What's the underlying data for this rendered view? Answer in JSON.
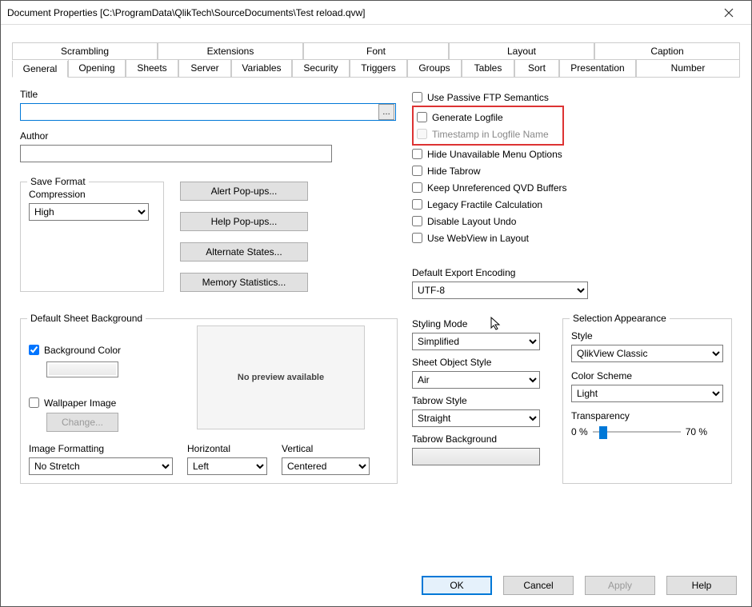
{
  "window": {
    "title": "Document Properties [C:\\ProgramData\\QlikTech\\SourceDocuments\\Test reload.qvw]"
  },
  "tabs_row1": [
    "Scrambling",
    "Extensions",
    "Font",
    "Layout",
    "Caption"
  ],
  "tabs_row2": [
    "General",
    "Opening",
    "Sheets",
    "Server",
    "Variables",
    "Security",
    "Triggers",
    "Groups",
    "Tables",
    "Sort",
    "Presentation",
    "Number"
  ],
  "active_tab": "General",
  "fields": {
    "title_label": "Title",
    "title_value": "",
    "author_label": "Author",
    "author_value": ""
  },
  "save_format": {
    "group_label": "Save Format",
    "compression_label": "Compression",
    "compression_value": "High"
  },
  "buttons_col": {
    "alert": "Alert Pop-ups...",
    "help": "Help Pop-ups...",
    "alt": "Alternate States...",
    "mem": "Memory Statistics..."
  },
  "checkboxes": {
    "passive_ftp": "Use Passive FTP Semantics",
    "gen_log": "Generate Logfile",
    "ts_log": "Timestamp in Logfile Name",
    "hide_menu": "Hide Unavailable Menu Options",
    "hide_tabrow": "Hide Tabrow",
    "keep_qvd": "Keep Unreferenced QVD Buffers",
    "legacy_frac": "Legacy Fractile Calculation",
    "disable_undo": "Disable Layout Undo",
    "webview": "Use WebView in Layout"
  },
  "export": {
    "label": "Default Export Encoding",
    "value": "UTF-8"
  },
  "sheet_bg": {
    "group_label": "Default Sheet Background",
    "bg_color": "Background Color",
    "wallpaper": "Wallpaper Image",
    "change": "Change...",
    "preview": "No preview available",
    "img_fmt_label": "Image Formatting",
    "img_fmt_value": "No Stretch",
    "horiz_label": "Horizontal",
    "horiz_value": "Left",
    "vert_label": "Vertical",
    "vert_value": "Centered"
  },
  "styling": {
    "mode_label": "Styling Mode",
    "mode_value": "Simplified",
    "obj_label": "Sheet Object Style",
    "obj_value": "Air",
    "tabrow_label": "Tabrow Style",
    "tabrow_value": "Straight",
    "tabrow_bg_label": "Tabrow Background"
  },
  "selection": {
    "group_label": "Selection Appearance",
    "style_label": "Style",
    "style_value": "QlikView Classic",
    "scheme_label": "Color Scheme",
    "scheme_value": "Light",
    "transp_label": "Transparency",
    "transp_min": "0 %",
    "transp_max": "70 %"
  },
  "footer": {
    "ok": "OK",
    "cancel": "Cancel",
    "apply": "Apply",
    "help": "Help"
  }
}
